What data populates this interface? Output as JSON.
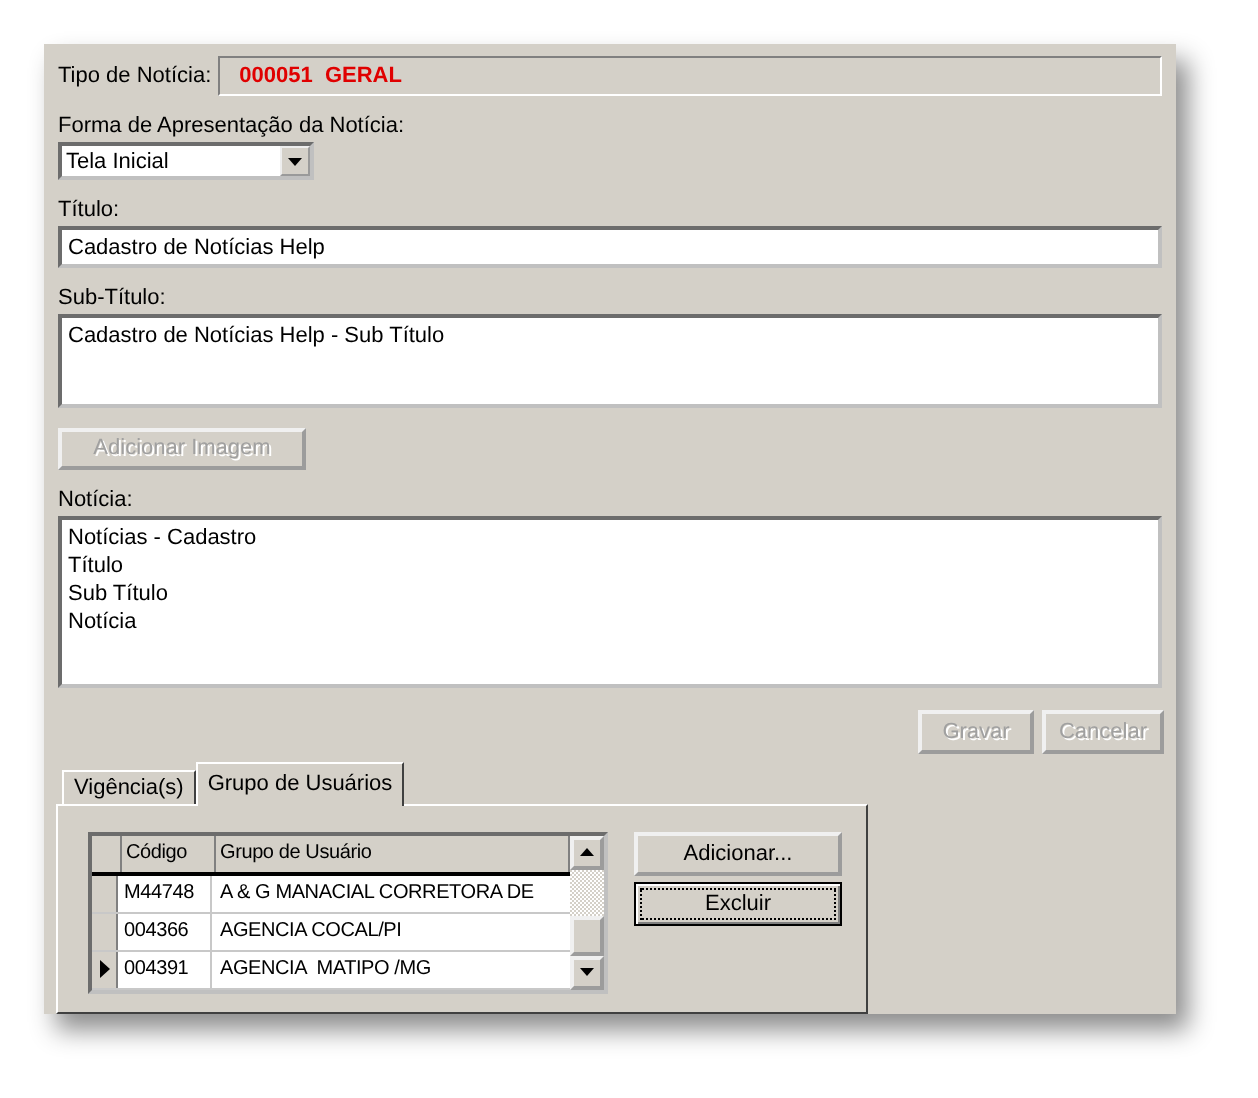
{
  "tipo": {
    "label": "Tipo de Notícia:",
    "value": "000051  GERAL"
  },
  "forma": {
    "label": "Forma de Apresentação da Notícia:",
    "value": "Tela Inicial"
  },
  "titulo": {
    "label": "Título:",
    "value": "Cadastro de Notícias Help"
  },
  "subtitulo": {
    "label": "Sub-Título:",
    "value": "Cadastro de Notícias Help - Sub Título"
  },
  "image_button": {
    "label": "Adicionar Imagem",
    "disabled": true
  },
  "noticia": {
    "label": "Notícia:",
    "lines": [
      "Notícias - Cadastro",
      "Título",
      "Sub Título",
      "Notícia"
    ]
  },
  "actions": [
    {
      "label": "Gravar",
      "disabled": true
    },
    {
      "label": "Cancelar",
      "disabled": true
    }
  ],
  "tabs": [
    {
      "label": "Vigência(s)",
      "selected": false
    },
    {
      "label": "Grupo de Usuários",
      "selected": true
    }
  ],
  "grid": {
    "columns": [
      "Código",
      "Grupo de Usuário"
    ],
    "rows": [
      {
        "cells": [
          "M44748",
          "A & G MANACIAL CORRETORA DE"
        ],
        "selected": false
      },
      {
        "cells": [
          "004366",
          "AGENCIA COCAL/PI"
        ],
        "selected": false
      },
      {
        "cells": [
          "004391",
          "AGENCIA  MATIPO /MG"
        ],
        "selected": true
      }
    ]
  },
  "grid_buttons": [
    {
      "label": "Adicionar...",
      "focused": false
    },
    {
      "label": "Excluir",
      "focused": true
    }
  ]
}
